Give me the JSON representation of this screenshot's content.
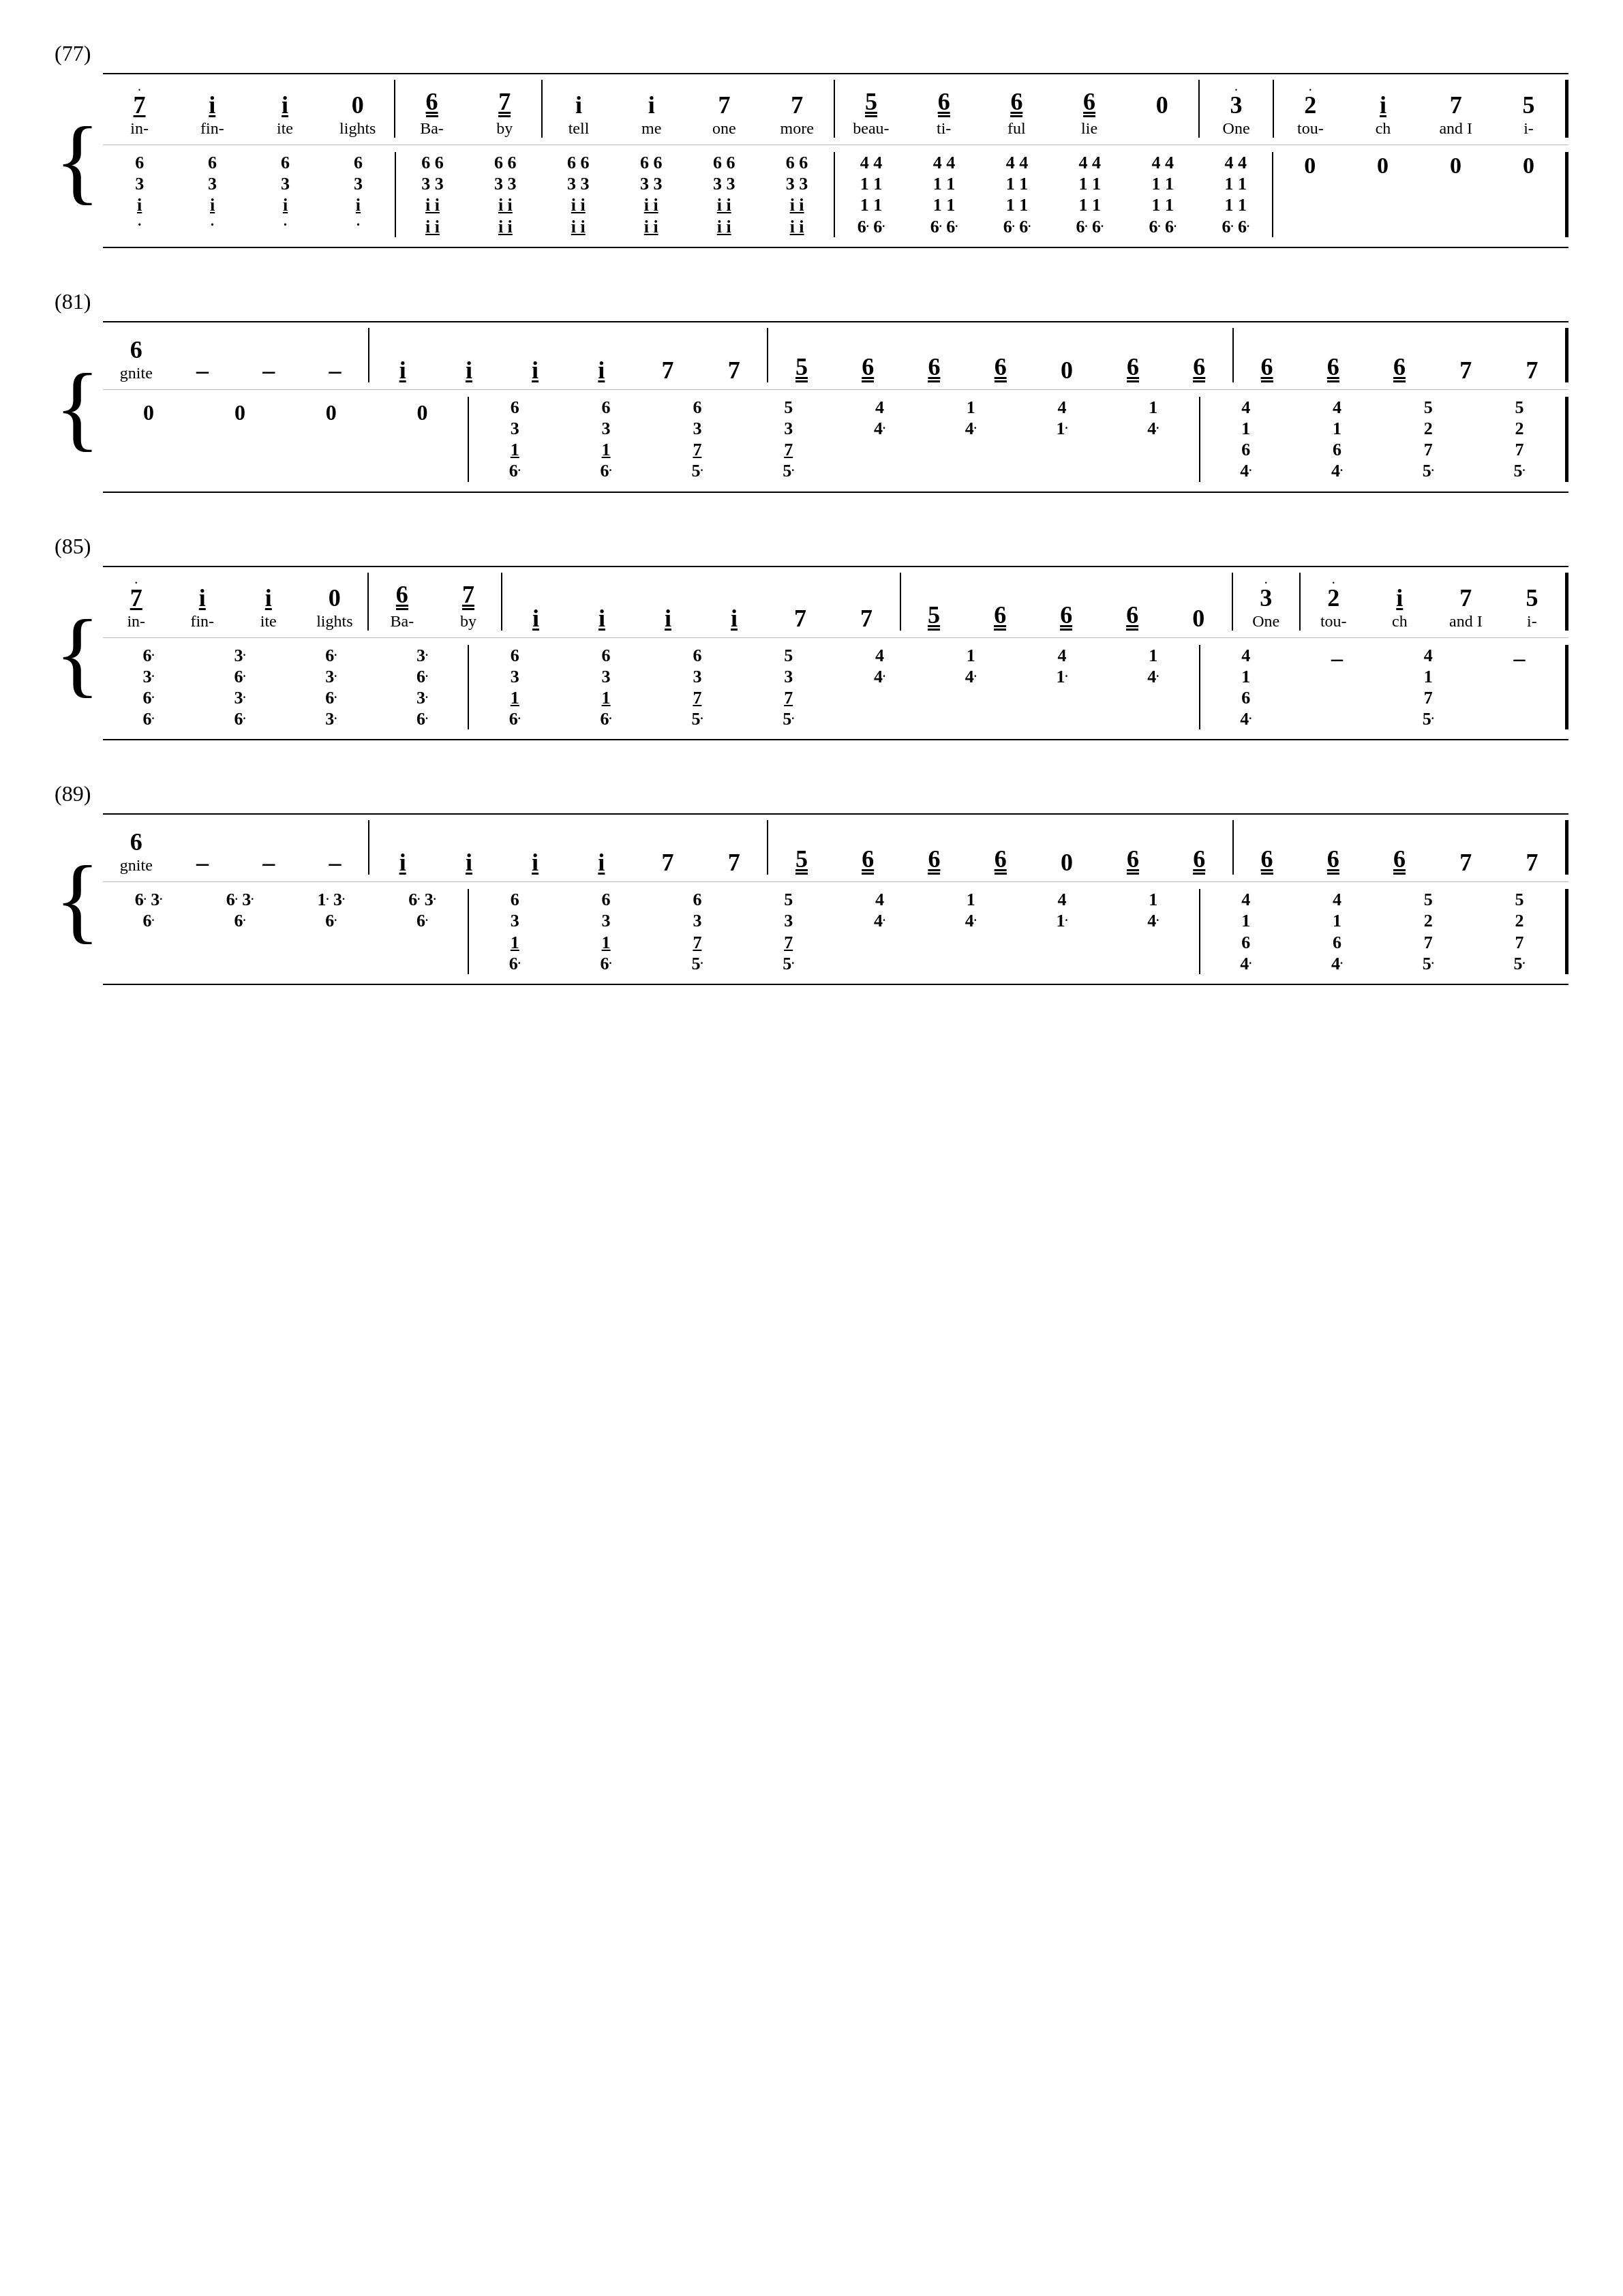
{
  "page": {
    "backgroundColor": "#ffffff",
    "sections": [
      {
        "id": "section-77",
        "label": "(77)",
        "melody": {
          "notes": [
            {
              "n": "7",
              "dot": true,
              "underline": 1,
              "lyric": "in-"
            },
            {
              "n": "i",
              "underline": 1,
              "lyric": "fin-"
            },
            {
              "n": "i",
              "underline": 1,
              "lyric": "ite"
            },
            {
              "n": "0",
              "lyric": "lights"
            },
            {
              "barline": true
            },
            {
              "n": "6",
              "underline": 2,
              "lyric": "Ba-"
            },
            {
              "n": "7",
              "underline": 2,
              "lyric": "by"
            },
            {
              "barline": true
            },
            {
              "n": "i",
              "lyric": "tell"
            },
            {
              "barline": false,
              "space": true
            },
            {
              "n": "i",
              "lyric": "me"
            },
            {
              "barline": false,
              "space": true
            },
            {
              "n": "7",
              "lyric": "one"
            },
            {
              "barline": false,
              "space": true
            },
            {
              "n": "7",
              "lyric": "more"
            },
            {
              "barline": true
            },
            {
              "n": "5",
              "underline": 2,
              "lyric": "beau-"
            },
            {
              "n": "6",
              "underline": 2,
              "lyric": "ti-"
            },
            {
              "n": "6",
              "underline": 2,
              "lyric": "ful"
            },
            {
              "n": "6",
              "underline": 2,
              "lyric": "lie"
            },
            {
              "n": "0",
              "lyric": ""
            },
            {
              "barline": true
            },
            {
              "n": "3",
              "dot": true,
              "lyric": "One"
            },
            {
              "barline": true
            },
            {
              "n": "2",
              "dot": true,
              "lyric": "tou-"
            },
            {
              "barline": false,
              "space": true
            },
            {
              "n": "i",
              "lyric": "ch"
            },
            {
              "barline": false,
              "space": true
            },
            {
              "n": "7",
              "lyric": "and I"
            },
            {
              "barline": false,
              "space": true
            },
            {
              "n": "5",
              "lyric": "i-"
            },
            {
              "barline": "end"
            }
          ]
        },
        "accomp": {
          "chords": [
            {
              "stack": [
                "6",
                "3",
                "i"
              ],
              "dot_bottom": true
            },
            {
              "stack": [
                "6",
                "3",
                "i"
              ],
              "dot_bottom": true
            },
            {
              "stack": [
                "6",
                "3",
                "i"
              ],
              "dot_bottom": true
            },
            {
              "stack": [
                "6",
                "3",
                "i"
              ],
              "dot_bottom": true
            },
            {
              "barline": true
            },
            {
              "stack": [
                "6",
                "6",
                "i",
                "i"
              ],
              "underlines": [
                0,
                0,
                1,
                1
              ]
            },
            {
              "stack": [
                "6",
                "6",
                "i",
                "i"
              ],
              "underlines": [
                0,
                0,
                1,
                1
              ]
            },
            {
              "stack": [
                "6",
                "6",
                "i",
                "i"
              ],
              "underlines": [
                0,
                0,
                1,
                1
              ]
            },
            {
              "stack": [
                "6",
                "6",
                "i",
                "i"
              ],
              "underlines": [
                0,
                0,
                1,
                1
              ]
            },
            {
              "stack": [
                "6",
                "6",
                "i",
                "i"
              ],
              "underlines": [
                0,
                0,
                1,
                1
              ]
            },
            {
              "stack": [
                "6",
                "6",
                "i",
                "i"
              ],
              "underlines": [
                0,
                0,
                1,
                1
              ]
            },
            {
              "barline": true
            },
            {
              "stack": [
                "4",
                "1",
                "6",
                "6"
              ],
              "underlines": [
                0,
                0,
                0,
                0
              ],
              "dots_bottom": [
                false,
                false,
                false,
                true
              ]
            },
            {
              "stack": [
                "4",
                "1",
                "6",
                "6"
              ],
              "dots_bottom": [
                false,
                false,
                false,
                true
              ]
            },
            {
              "stack": [
                "4",
                "1",
                "6",
                "6"
              ],
              "dots_bottom": [
                false,
                false,
                false,
                true
              ]
            },
            {
              "stack": [
                "4",
                "1",
                "6",
                "6"
              ],
              "dots_bottom": [
                false,
                false,
                false,
                true
              ]
            },
            {
              "stack": [
                "4",
                "1",
                "6",
                "6"
              ],
              "dots_bottom": [
                false,
                false,
                false,
                true
              ]
            },
            {
              "stack": [
                "4",
                "1",
                "6",
                "6"
              ],
              "dots_bottom": [
                false,
                false,
                false,
                true
              ]
            },
            {
              "barline": true
            },
            {
              "n": "0"
            },
            {
              "n": "0"
            },
            {
              "n": "0"
            },
            {
              "n": "0"
            },
            {
              "barline": "end"
            }
          ]
        }
      },
      {
        "id": "section-81",
        "label": "(81)",
        "melody": {
          "notes": [
            {
              "n": "6",
              "lyric": "gnite"
            },
            {
              "n": "–"
            },
            {
              "n": "–"
            },
            {
              "n": "–"
            },
            {
              "barline": true
            },
            {
              "n": "i",
              "underline": 1
            },
            {
              "n": "i",
              "underline": 1
            },
            {
              "n": "i",
              "underline": 1
            },
            {
              "n": "i",
              "underline": 1
            },
            {
              "n": "7"
            },
            {
              "n": "7"
            },
            {
              "barline": true
            },
            {
              "n": "5",
              "underline": 2
            },
            {
              "n": "6",
              "underline": 2
            },
            {
              "n": "6",
              "underline": 2
            },
            {
              "n": "6",
              "underline": 2
            },
            {
              "n": "0"
            },
            {
              "n": "6",
              "underline": 2
            },
            {
              "n": "6",
              "underline": 2
            },
            {
              "barline": true
            },
            {
              "n": "6",
              "underline": 2
            },
            {
              "n": "6",
              "underline": 2
            },
            {
              "n": "6",
              "underline": 2
            },
            {
              "n": "7"
            },
            {
              "n": "7"
            },
            {
              "barline": "end"
            }
          ]
        }
      },
      {
        "id": "section-85",
        "label": "(85)"
      },
      {
        "id": "section-89",
        "label": "(89)"
      }
    ]
  }
}
